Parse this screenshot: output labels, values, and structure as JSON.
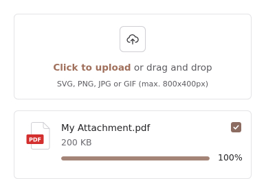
{
  "dropzone": {
    "icon": "cloud-upload-icon",
    "click_label": "Click to upload",
    "drag_label": " or drag and drop",
    "hint": "SVG, PNG, JPG or GIF (max. 800x400px)"
  },
  "file": {
    "icon": "pdf-file-icon",
    "badge": "PDF",
    "name": "My Attachment.pdf",
    "size": "200 KB",
    "checked": true,
    "progress_percent": 100,
    "progress_label": "100%"
  },
  "colors": {
    "accent": "#a0705c",
    "checkbox": "#8c6b60",
    "progress_fill": "#a58478",
    "progress_track": "#e8e2df",
    "pdf_badge": "#d32f2f"
  }
}
